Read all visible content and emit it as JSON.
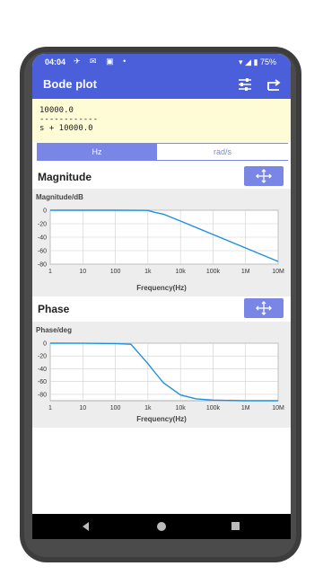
{
  "status": {
    "time": "04:04",
    "icons": "✈ ✉ ▣ •",
    "battery": "75%"
  },
  "appbar": {
    "title": "Bode plot",
    "settings_icon": "sliders-icon",
    "export_icon": "share-icon"
  },
  "formula": {
    "numerator": "10000.0",
    "divider": "------------",
    "denominator": "s + 10000.0"
  },
  "units": {
    "hz": "Hz",
    "rad": "rad/s",
    "selected": "Hz"
  },
  "magnitude": {
    "title": "Magnitude",
    "ylabel": "Magnitude/dB",
    "xlabel": "Frequency(Hz)",
    "yticks": [
      "0",
      "-20",
      "-40",
      "-60",
      "-80"
    ],
    "xticks": [
      "1",
      "10",
      "100",
      "1k",
      "10k",
      "100k",
      "1M",
      "10M"
    ]
  },
  "phase": {
    "title": "Phase",
    "ylabel": "Phase/deg",
    "xlabel": "Frequency(Hz)",
    "yticks": [
      "0",
      "-20",
      "-40",
      "-60",
      "-80"
    ],
    "xticks": [
      "1",
      "10",
      "100",
      "1k",
      "10k",
      "100k",
      "1M",
      "10M"
    ]
  },
  "chart_data": [
    {
      "type": "line",
      "ylabel": "Magnitude/dB",
      "xlabel": "Frequency(Hz)",
      "xscale": "log",
      "xlim": [
        1,
        10000000
      ],
      "ylim": [
        -80,
        0
      ],
      "grid": true,
      "series": [
        {
          "x": [
            1,
            10,
            100,
            1000,
            1591,
            3000,
            10000,
            100000,
            1000000,
            10000000
          ],
          "y": [
            0,
            0,
            0,
            -0.2,
            -3,
            -5.9,
            -16,
            -36,
            -56,
            -76
          ],
          "color": "#1f8fe0"
        }
      ]
    },
    {
      "type": "line",
      "ylabel": "Phase/deg",
      "xlabel": "Frequency(Hz)",
      "xscale": "log",
      "xlim": [
        1,
        10000000
      ],
      "ylim": [
        -90,
        0
      ],
      "grid": true,
      "series": [
        {
          "x": [
            1,
            10,
            100,
            300,
            1000,
            1591,
            3000,
            10000,
            30000,
            100000,
            1000000,
            10000000
          ],
          "y": [
            0,
            -0.1,
            -0.6,
            -1.7,
            -32,
            -45,
            -62,
            -81,
            -87,
            -89,
            -90,
            -90
          ],
          "color": "#1f8fe0"
        }
      ]
    }
  ]
}
